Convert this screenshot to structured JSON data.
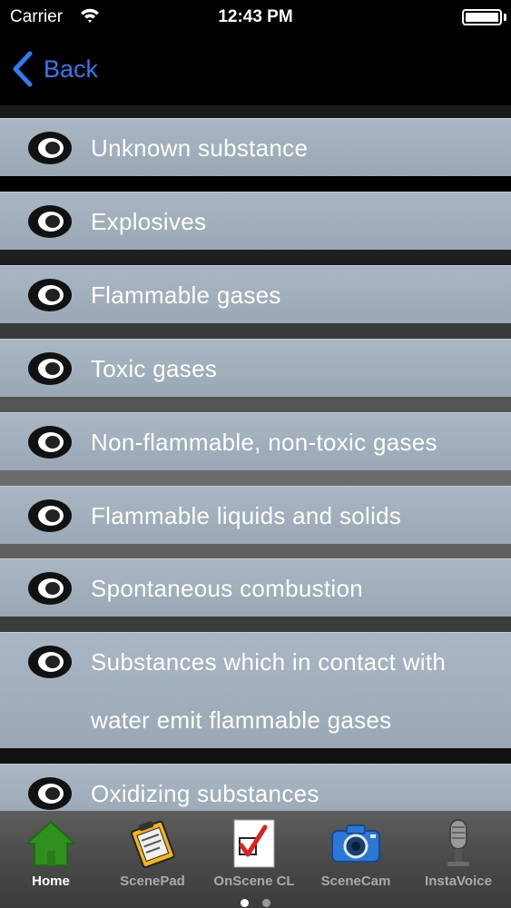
{
  "status_bar": {
    "carrier": "Carrier",
    "time": "12:43 PM"
  },
  "nav": {
    "back_label": "Back",
    "accent_color": "#2f7bf5"
  },
  "list": {
    "items": [
      {
        "label": "Unknown substance"
      },
      {
        "label": "Explosives"
      },
      {
        "label": "Flammable gases"
      },
      {
        "label": "Toxic gases"
      },
      {
        "label": "Non-flammable, non-toxic gases"
      },
      {
        "label": "Flammable liquids and solids"
      },
      {
        "label": "Spontaneous combustion"
      },
      {
        "label": "Substances which in contact with water emit flammable gases"
      },
      {
        "label": "Oxidizing substances"
      }
    ],
    "item_icon": "eye-icon"
  },
  "tab_bar": {
    "tabs": [
      {
        "label": "Home",
        "icon": "house-icon",
        "active": true
      },
      {
        "label": "ScenePad",
        "icon": "notepad-icon",
        "active": false
      },
      {
        "label": "OnScene CL",
        "icon": "checklist-icon",
        "active": false
      },
      {
        "label": "SceneCam",
        "icon": "camera-icon",
        "active": false
      },
      {
        "label": "InstaVoice",
        "icon": "microphone-icon",
        "active": false
      }
    ],
    "pages": 2,
    "current_page": 1
  }
}
